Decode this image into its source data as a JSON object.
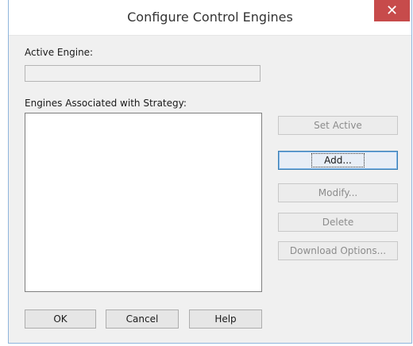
{
  "window": {
    "title": "Configure Control Engines",
    "close_glyph": "✕"
  },
  "active_engine": {
    "label": "Active Engine:",
    "value": ""
  },
  "engines": {
    "label": "Engines Associated with Strategy:",
    "items": []
  },
  "side_buttons": {
    "set_active": "Set Active",
    "add": "Add...",
    "modify": "Modify...",
    "delete": "Delete",
    "download_options": "Download Options..."
  },
  "bottom_buttons": {
    "ok": "OK",
    "cancel": "Cancel",
    "help": "Help"
  },
  "colors": {
    "close_button": "#c74b4b",
    "default_button_border": "#3c7fb1"
  }
}
